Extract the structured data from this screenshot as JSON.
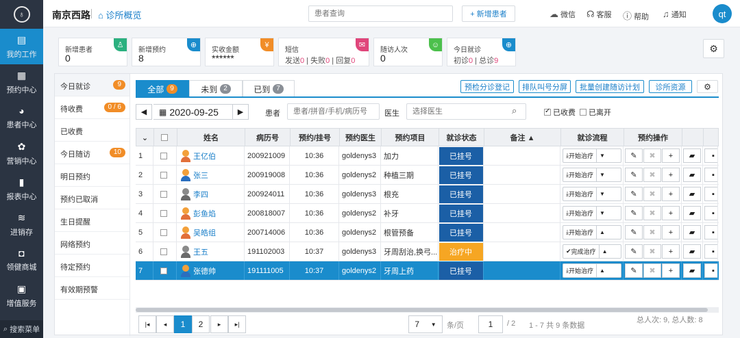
{
  "nav": {
    "items": [
      {
        "label": "我的工作",
        "icon": "workbench-icon",
        "glyph": "▤"
      },
      {
        "label": "预约中心",
        "icon": "calendar-icon",
        "glyph": "▦"
      },
      {
        "label": "患者中心",
        "icon": "users-icon",
        "glyph": "◕"
      },
      {
        "label": "营销中心",
        "icon": "marketing-icon",
        "glyph": "✿"
      },
      {
        "label": "报表中心",
        "icon": "chart-icon",
        "glyph": "▮"
      },
      {
        "label": "进销存",
        "icon": "layers-icon",
        "glyph": "≋"
      },
      {
        "label": "领健商城",
        "icon": "mall-icon",
        "glyph": "◘"
      },
      {
        "label": "增值服务",
        "icon": "apps-icon",
        "glyph": "▣"
      }
    ],
    "search_label": "搜索菜单"
  },
  "header": {
    "clinic": "南京西路",
    "overview": "诊所概览",
    "search_placeholder": "患者查询",
    "add_patient": "+ 新增患者",
    "wechat": "微信",
    "service": "客服",
    "help": "帮助",
    "notify": "通知",
    "user": "qt"
  },
  "stats": [
    {
      "label": "新增患者",
      "value": "0",
      "color": "#2bb07f",
      "glyph": "♙"
    },
    {
      "label": "新增预约",
      "value": "8",
      "color": "#1a8ccc",
      "glyph": "⊕"
    },
    {
      "label": "实收金额",
      "value": "******",
      "color": "#f18d27",
      "glyph": "¥"
    },
    {
      "label": "短信",
      "color": "#e0467b",
      "glyph": "✉",
      "parts": [
        {
          "k": "发送",
          "v": "0"
        },
        {
          "k": "失败",
          "v": "0"
        },
        {
          "k": "回复",
          "v": "0"
        }
      ]
    },
    {
      "label": "随访人次",
      "value": "0",
      "color": "#4cc04c",
      "glyph": "☺"
    },
    {
      "label": "今日就诊",
      "color": "#1a8ccc",
      "glyph": "⊕",
      "parts": [
        {
          "k": "初诊",
          "v": "0"
        },
        {
          "k": "总诊",
          "v": "9"
        }
      ]
    }
  ],
  "side": [
    {
      "label": "今日就诊",
      "badge": "9"
    },
    {
      "label": "待收费",
      "badge": "0 / 6"
    },
    {
      "label": "已收费"
    },
    {
      "label": "今日随访",
      "badge": "10"
    },
    {
      "label": "明日预约"
    },
    {
      "label": "预约已取消"
    },
    {
      "label": "生日提醒"
    },
    {
      "label": "网络预约"
    },
    {
      "label": "待定预约"
    },
    {
      "label": "有效期预警"
    }
  ],
  "tabs": [
    {
      "label": "全部",
      "count": "9"
    },
    {
      "label": "未到",
      "count": "2"
    },
    {
      "label": "已到",
      "count": "7"
    }
  ],
  "tool_buttons": [
    "预检分诊登记",
    "排队叫号分屏",
    "批量创建随访计划",
    "诊所资源"
  ],
  "filter": {
    "date": "2020-09-25",
    "patient_label": "患者",
    "patient_placeholder": "患者/拼音/手机/病历号",
    "doctor_label": "医生",
    "doctor_placeholder": "选择医生",
    "charged": "已收费",
    "left": "已离开"
  },
  "columns": {
    "name": "姓名",
    "record": "病历号",
    "reg": "预约/挂号",
    "doctor": "预约医生",
    "item": "预约项目",
    "status": "就诊状态",
    "note": "备注 ▲",
    "flow": "就诊流程",
    "ops": "预约操作"
  },
  "rows": [
    {
      "n": "1",
      "name": "王亿伯",
      "gender": "f",
      "record": "200921009",
      "time": "10:36",
      "doctor": "goldenys3",
      "item": "加力",
      "status": "已挂号",
      "flow": "开始治疗"
    },
    {
      "n": "2",
      "name": "张三",
      "gender": "m",
      "record": "200919008",
      "time": "10:36",
      "doctor": "goldenys2",
      "item": "种植三期",
      "status": "已挂号",
      "flow": "开始治疗"
    },
    {
      "n": "3",
      "name": "李四",
      "gender": "u",
      "record": "200924011",
      "time": "10:36",
      "doctor": "goldenys3",
      "item": "根充",
      "status": "已挂号",
      "flow": "开始治疗"
    },
    {
      "n": "4",
      "name": "彭鱼焰",
      "gender": "f",
      "record": "200818007",
      "time": "10:36",
      "doctor": "goldenys2",
      "item": "补牙",
      "status": "已挂号",
      "flow": "开始治疗"
    },
    {
      "n": "5",
      "name": "吴皓组",
      "gender": "f",
      "record": "200714006",
      "time": "10:36",
      "doctor": "goldenys2",
      "item": "根管预备",
      "status": "已挂号",
      "flow": "开始治疗"
    },
    {
      "n": "6",
      "name": "王五",
      "gender": "u",
      "record": "191102003",
      "time": "10:37",
      "doctor": "goldenys3",
      "item": "牙周刮治,换弓...",
      "status": "治疗中",
      "flow": "完成治疗"
    },
    {
      "n": "7",
      "name": "张德帅",
      "gender": "m",
      "record": "191111005",
      "time": "10:37",
      "doctor": "goldenys2",
      "item": "牙周上药",
      "status": "已挂号",
      "flow": "开始治疗",
      "selected": true
    }
  ],
  "footer": {
    "pages": [
      "1",
      "2"
    ],
    "page_size": "7",
    "per_page": "条/页",
    "current_page": "1",
    "total_pages": "/ 2",
    "range": "1 - 7 共 9 条数据",
    "summary": "总人次: 9, 总人数: 8"
  },
  "colors": {
    "accent": "#1a8ccc",
    "status_registered": "#1b5fa6",
    "status_treating": "#f6a623"
  }
}
